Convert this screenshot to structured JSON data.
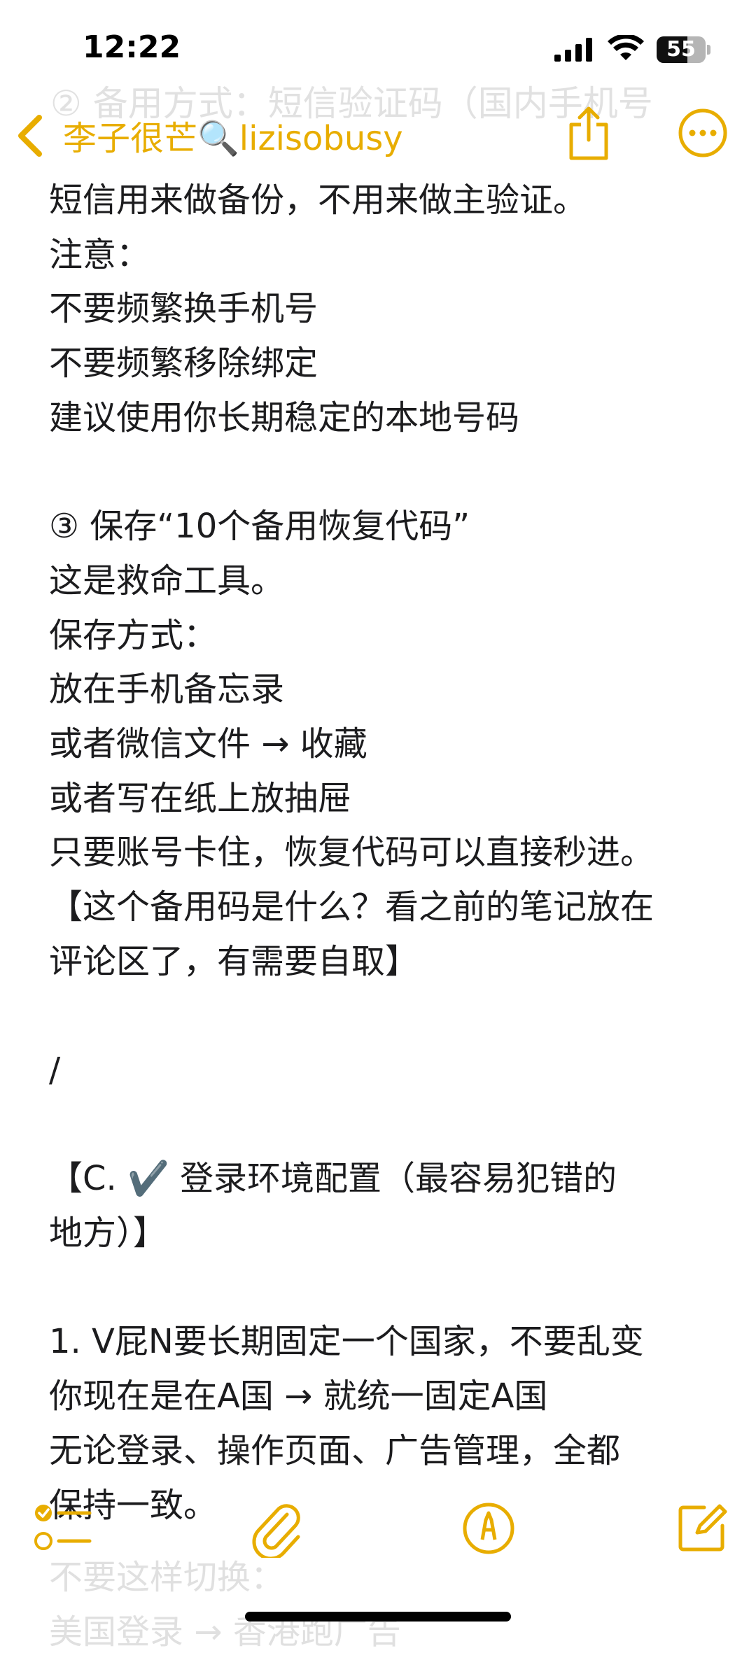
{
  "status": {
    "time": "12:22",
    "battery": "55"
  },
  "nav": {
    "back_label": "李子很芒🔍lizisobusy",
    "partial_top_line": "② 备用方式：短信验证码（国内手机号"
  },
  "note_lines": [
    "短信用来做备份，不用来做主验证。",
    "注意：",
    "不要频繁换手机号",
    "不要频繁移除绑定",
    "建议使用你长期稳定的本地号码",
    "",
    "③ 保存“10个备用恢复代码”",
    "这是救命工具。",
    "保存方式：",
    "放在手机备忘录",
    "或者微信文件 → 收藏",
    "或者写在纸上放抽屉",
    "只要账号卡住，恢复代码可以直接秒进。",
    "【这个备用码是什么？看之前的笔记放在",
    "评论区了，有需要自取】",
    "",
    "/",
    "",
    "【C. ✔️ 登录环境配置（最容易犯错的",
    "地方）】",
    "",
    "1. V屁N要长期固定一个国家，不要乱变",
    "你现在是在A国 → 就统一固定A国",
    "无论登录、操作页面、广告管理，全都",
    "保持一致。"
  ],
  "under_toolbar_lines": [
    "不要这样切换：",
    "美国登录 → 香港跑广告"
  ],
  "colors": {
    "accent": "#e8ad00",
    "text": "#1c1c1e"
  },
  "icons": [
    "chevron-left-icon",
    "share-icon",
    "more-icon",
    "checklist-icon",
    "paperclip-icon",
    "markup-pen-icon",
    "compose-icon"
  ]
}
